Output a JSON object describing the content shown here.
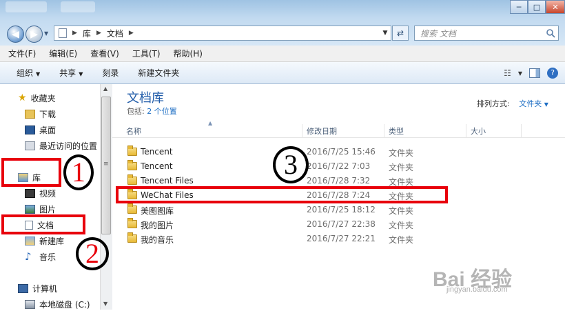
{
  "window": {
    "minimize": "─",
    "maximize": "□",
    "close": "✕"
  },
  "nav": {
    "back_icon": "back-arrow-icon",
    "forward_icon": "forward-arrow-icon"
  },
  "address": {
    "crumbs": [
      "库",
      "文档"
    ],
    "refresh_icon": "refresh-icon"
  },
  "search": {
    "placeholder": "搜索 文档"
  },
  "menu": [
    "文件(F)",
    "编辑(E)",
    "查看(V)",
    "工具(T)",
    "帮助(H)"
  ],
  "toolbar": {
    "organize": "组织",
    "share": "共享",
    "burn": "刻录",
    "new_folder": "新建文件夹"
  },
  "sidebar": {
    "favorites": "收藏夹",
    "downloads": "下载",
    "desktop": "桌面",
    "recent": "最近访问的位置",
    "libraries": "库",
    "videos": "视频",
    "pictures": "图片",
    "documents": "文档",
    "new_library": "新建库",
    "music": "音乐",
    "computer": "计算机",
    "local_disk": "本地磁盘 (C:)"
  },
  "library": {
    "title": "文档库",
    "includes_prefix": "包括:",
    "includes_link": "2 个位置",
    "arrange_label": "排列方式:",
    "arrange_value": "文件夹"
  },
  "columns": {
    "name": "名称",
    "date": "修改日期",
    "type": "类型",
    "size": "大小"
  },
  "files": [
    {
      "name": "Tencent",
      "date": "2016/7/25 15:46",
      "type": "文件夹"
    },
    {
      "name": "Tencent",
      "date": "2016/7/22 7:03",
      "type": "文件夹"
    },
    {
      "name": "Tencent Files",
      "date": "2016/7/28 7:32",
      "type": "文件夹"
    },
    {
      "name": "WeChat Files",
      "date": "2016/7/28 7:24",
      "type": "文件夹"
    },
    {
      "name": "美图图库",
      "date": "2016/7/25 18:12",
      "type": "文件夹"
    },
    {
      "name": "我的图片",
      "date": "2016/7/27 22:38",
      "type": "文件夹"
    },
    {
      "name": "我的音乐",
      "date": "2016/7/27 22:21",
      "type": "文件夹"
    }
  ],
  "annotations": {
    "one": "1",
    "two": "2",
    "three": "3"
  },
  "watermark": {
    "brand": "Bai 经验",
    "url": "jingyan.baidu.com"
  },
  "colors": {
    "highlight": "#e8000b",
    "link": "#1f6fc4",
    "title": "#1e5aa8"
  }
}
